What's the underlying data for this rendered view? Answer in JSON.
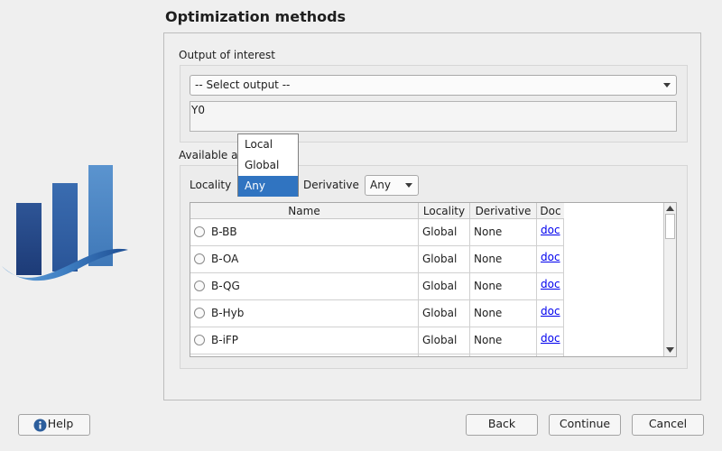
{
  "page": {
    "title": "Optimization methods"
  },
  "output_section": {
    "label": "Output of interest",
    "select": {
      "value": "-- Select output --"
    },
    "outputs_text": "Y0"
  },
  "algorithms_section": {
    "label": "Available a",
    "locality_label": "Locality",
    "derivative_label": "Derivative",
    "derivative_select": {
      "value": "Any"
    },
    "locality_popup": {
      "options": [
        "Local",
        "Global",
        "Any"
      ],
      "selected": "Any"
    }
  },
  "table": {
    "headers": [
      "Name",
      "Locality",
      "Derivative",
      "Doc"
    ],
    "rows": [
      {
        "name": "B-BB",
        "locality": "Global",
        "derivative": "None",
        "doc": "doc"
      },
      {
        "name": "B-OA",
        "locality": "Global",
        "derivative": "None",
        "doc": "doc"
      },
      {
        "name": "B-QG",
        "locality": "Global",
        "derivative": "None",
        "doc": "doc"
      },
      {
        "name": "B-Hyb",
        "locality": "Global",
        "derivative": "None",
        "doc": "doc"
      },
      {
        "name": "B-iFP",
        "locality": "Global",
        "derivative": "None",
        "doc": "doc"
      }
    ]
  },
  "buttons": {
    "help": "Help",
    "back": "Back",
    "continue": "Continue",
    "cancel": "Cancel"
  },
  "colors": {
    "selection": "#3074c1",
    "link": "#0000ee",
    "logo_dark": "#1f3c78",
    "logo_light": "#5b94cf"
  },
  "icons": [
    "chart-logo-icon",
    "info-icon",
    "chevron-down-icon",
    "chevron-up-icon",
    "radio-icon"
  ]
}
